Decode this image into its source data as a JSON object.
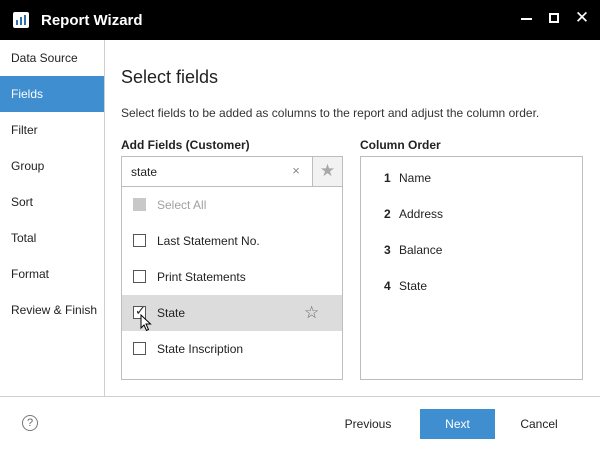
{
  "window": {
    "title": "Report Wizard",
    "icons": {
      "app": "report-chart-icon",
      "minimize": "minimize-icon",
      "maximize": "maximize-icon",
      "close": "close-icon"
    }
  },
  "sidebar": {
    "items": [
      {
        "label": "Data Source",
        "active": false
      },
      {
        "label": "Fields",
        "active": true
      },
      {
        "label": "Filter",
        "active": false
      },
      {
        "label": "Group",
        "active": false
      },
      {
        "label": "Sort",
        "active": false
      },
      {
        "label": "Total",
        "active": false
      },
      {
        "label": "Format",
        "active": false
      },
      {
        "label": "Review & Finish",
        "active": false
      }
    ]
  },
  "main": {
    "heading": "Select fields",
    "description": "Select fields to be added as columns to the report and adjust the column order.",
    "add_fields_label": "Add Fields (Customer)",
    "column_order_label": "Column Order",
    "search": {
      "value": "state",
      "clear_icon": "×",
      "favorites_icon": "★"
    },
    "select_all_label": "Select All",
    "fields": [
      {
        "label": "Last Statement No.",
        "checked": false,
        "selected": false
      },
      {
        "label": "Print Statements",
        "checked": false,
        "selected": false
      },
      {
        "label": "State",
        "checked": true,
        "selected": true,
        "star_icon": "☆"
      },
      {
        "label": "State Inscription",
        "checked": false,
        "selected": false
      }
    ],
    "column_order": [
      {
        "num": "1",
        "name": "Name"
      },
      {
        "num": "2",
        "name": "Address"
      },
      {
        "num": "3",
        "name": "Balance"
      },
      {
        "num": "4",
        "name": "State"
      }
    ]
  },
  "footer": {
    "help_icon": "?",
    "previous_label": "Previous",
    "next_label": "Next",
    "cancel_label": "Cancel"
  },
  "colors": {
    "accent": "#3e8ed0",
    "titlebar": "#000000",
    "selected_row": "#dcdcdc"
  }
}
